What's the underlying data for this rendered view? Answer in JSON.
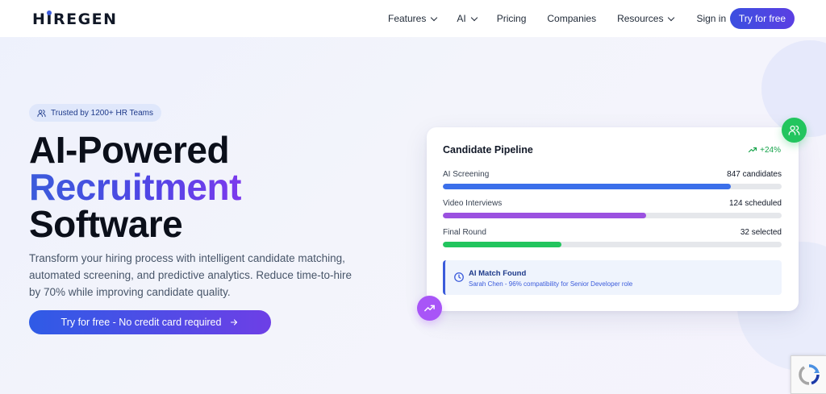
{
  "brand": {
    "logo_text": "HIREGEN"
  },
  "nav": {
    "items": [
      {
        "label": "Features",
        "dropdown": true
      },
      {
        "label": "AI",
        "dropdown": true
      },
      {
        "label": "Pricing",
        "dropdown": false
      },
      {
        "label": "Companies",
        "dropdown": false
      },
      {
        "label": "Resources",
        "dropdown": true
      },
      {
        "label": "Sign in",
        "dropdown": false
      }
    ],
    "cta_label": "Try for free"
  },
  "hero": {
    "badge_text": "Trusted by 1200+ HR Teams",
    "title_line1": "AI-Powered",
    "title_line2": "Recruitment",
    "title_line3": "Software",
    "description": "Transform your hiring process with intelligent candidate matching, automated screening, and predictive analytics. Reduce time-to-hire by 70% while improving candidate quality.",
    "cta_label": "Try for free - No credit card required"
  },
  "pipeline": {
    "title": "Candidate Pipeline",
    "trend": "+24%",
    "rows": [
      {
        "label": "AI Screening",
        "count": "847 candidates",
        "progress": 0.85,
        "color": "#3b6fea"
      },
      {
        "label": "Video Interviews",
        "count": "124 scheduled",
        "progress": 0.6,
        "color": "#9b51e0"
      },
      {
        "label": "Final Round",
        "count": "32 selected",
        "progress": 0.35,
        "color": "#22c55e"
      }
    ],
    "alert": {
      "title": "AI Match Found",
      "subtitle": "Sarah Chen - 96% compatibility for Senior Developer role"
    }
  },
  "colors": {
    "accent_blue": "#3b5bdb",
    "accent_purple": "#7c3aed",
    "success_green": "#22c55e"
  },
  "icons": {
    "badge": "users-icon",
    "trend": "trending-up-icon",
    "alert": "clock-icon",
    "float_green": "users-icon",
    "float_purple": "trending-up-icon",
    "cta": "arrow-right-icon",
    "captcha": "recaptcha-icon"
  }
}
